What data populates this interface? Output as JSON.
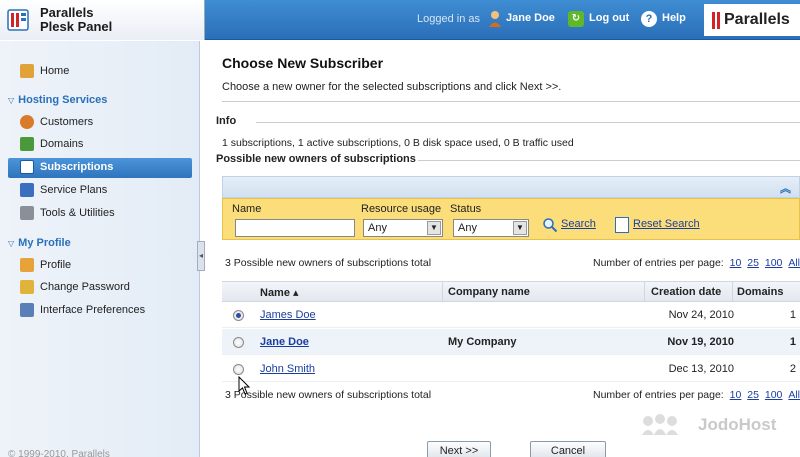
{
  "header": {
    "brand_line1": "Parallels",
    "brand_line2": "Plesk Panel",
    "logged_in_as": "Logged in as",
    "user_name": "Jane Doe",
    "logout_label": "Log out",
    "help_label": "Help",
    "parallels_logo_text": "Parallels",
    "accent_color": "#2a6fb9"
  },
  "sidebar": {
    "home": "Home",
    "hosting_group": "Hosting Services",
    "customers": "Customers",
    "domains": "Domains",
    "subscriptions": "Subscriptions",
    "service_plans": "Service Plans",
    "tools": "Tools & Utilities",
    "profile_group": "My Profile",
    "profile": "Profile",
    "change_password": "Change Password",
    "interface_prefs": "Interface Preferences",
    "footer": "© 1999-2010, Parallels"
  },
  "main": {
    "title": "Choose New Subscriber",
    "description": "Choose a new owner for the selected subscriptions and click Next >>.",
    "info_heading": "Info",
    "info_text": "1 subscriptions, 1 active subscriptions, 0 B disk space used, 0 B traffic used",
    "owners_heading": "Possible new owners of subscriptions"
  },
  "search": {
    "name_label": "Name",
    "name_value": "",
    "resource_label": "Resource usage",
    "resource_value": "Any",
    "status_label": "Status",
    "status_value": "Any",
    "search_link": "Search",
    "reset_link": "Reset Search"
  },
  "table": {
    "total_text": "3 Possible new owners of subscriptions total",
    "entries_label": "Number of entries per page:",
    "page_sizes": [
      "10",
      "25",
      "100",
      "All"
    ],
    "columns": [
      "Name ▴",
      "Company name",
      "Creation date",
      "Domains"
    ],
    "rows": [
      {
        "name": "James Doe",
        "company": "",
        "created": "Nov 24, 2010",
        "domains": "1",
        "selected": true
      },
      {
        "name": "Jane Doe",
        "company": "My Company",
        "created": "Nov 19, 2010",
        "domains": "1",
        "selected": false
      },
      {
        "name": "John Smith",
        "company": "",
        "created": "Dec 13, 2010",
        "domains": "2",
        "selected": false
      }
    ]
  },
  "buttons": {
    "next": "Next >>",
    "cancel": "Cancel"
  },
  "watermark": "JodoHost"
}
